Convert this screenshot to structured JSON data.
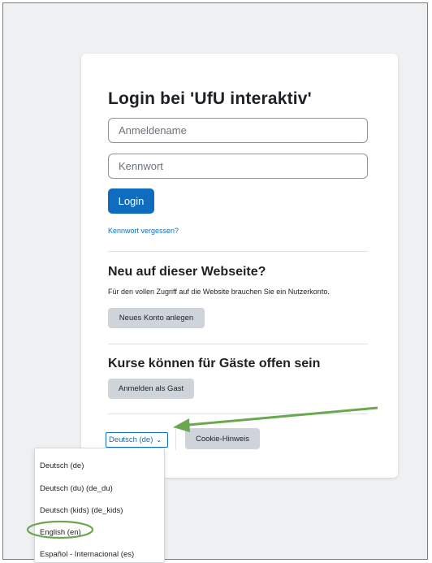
{
  "login": {
    "title": "Login bei 'UfU interaktiv'",
    "username_placeholder": "Anmeldename",
    "password_placeholder": "Kennwort",
    "login_button": "Login",
    "forgot_link": "Kennwort vergessen?"
  },
  "signup": {
    "heading": "Neu auf dieser Webseite?",
    "text": "Für den vollen Zugriff auf die Website brauchen Sie ein Nutzerkonto.",
    "button": "Neues Konto anlegen"
  },
  "guest": {
    "heading": "Kurse können für Gäste offen sein",
    "button": "Anmelden als Gast"
  },
  "footer": {
    "language_selected": "Deutsch (de)",
    "cookie_button": "Cookie-Hinweis"
  },
  "language_menu": {
    "items": [
      "Deutsch (de)",
      "Deutsch (du) (de_du)",
      "Deutsch (kids) (de_kids)",
      "English (en)",
      "Español - Internacional (es)"
    ],
    "highlighted": "English (en)"
  },
  "annotations": {
    "arrow_color": "#6aa84f",
    "highlight_color": "#6aa84f"
  },
  "colors": {
    "primary": "#0f6cbf",
    "secondary_button": "#ced4da",
    "page_background": "#eef0f2"
  }
}
